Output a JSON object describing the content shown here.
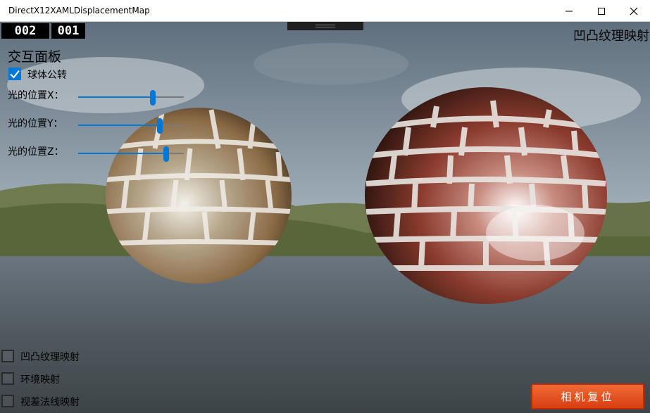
{
  "window": {
    "title": "DirectX12XAMLDisplacementMap"
  },
  "counters": {
    "left": "002",
    "right": "001"
  },
  "scene": {
    "title": "凹凸纹理映射"
  },
  "panel": {
    "title": "交互面板",
    "revolve_label": "球体公转",
    "revolve_checked": true,
    "slider_x_label": "光的位置X：",
    "slider_y_label": "光的位置Y：",
    "slider_z_label": "光的位置Z：",
    "slider_x_value": 0.72,
    "slider_y_value": 0.79,
    "slider_z_value": 0.85
  },
  "options": [
    {
      "label": "凹凸纹理映射",
      "checked": false
    },
    {
      "label": "环境映射",
      "checked": false
    },
    {
      "label": "视差法线映射",
      "checked": false
    }
  ],
  "reset_button": {
    "label": "相机复位"
  },
  "colors": {
    "accent": "#0078d7",
    "button": "#e8521d"
  }
}
